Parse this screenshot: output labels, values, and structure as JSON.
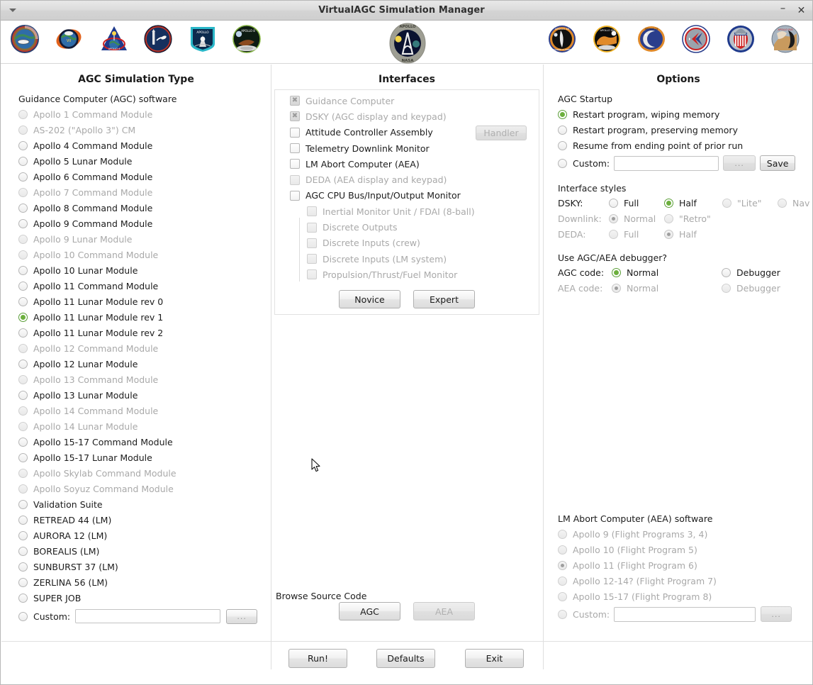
{
  "window": {
    "title": "VirtualAGC Simulation Manager",
    "menu_icon": "caret-down-icon",
    "minimize_label": "–",
    "close_label": "✕"
  },
  "patches": {
    "left": [
      "apollo-1-patch",
      "apollo-as202-patch",
      "apollo-4-patch",
      "apollo-5-patch",
      "apollo-6-patch",
      "apollo-7-patch"
    ],
    "center": "apollo-program-patch",
    "right": [
      "apollo-12-patch",
      "apollo-13-patch",
      "apollo-14-patch",
      "apollo-15-patch",
      "apollo-16-patch",
      "apollo-17-patch"
    ]
  },
  "columns": {
    "agc_sim_type": "AGC Simulation Type",
    "interfaces": "Interfaces",
    "options": "Options"
  },
  "agc_software": {
    "label": "Guidance Computer (AGC) software",
    "items": [
      {
        "label": "Apollo 1 Command Module",
        "enabled": false,
        "selected": false
      },
      {
        "label": "AS-202 (\"Apollo 3\") CM",
        "enabled": false,
        "selected": false
      },
      {
        "label": "Apollo 4 Command Module",
        "enabled": true,
        "selected": false
      },
      {
        "label": "Apollo 5 Lunar Module",
        "enabled": true,
        "selected": false
      },
      {
        "label": "Apollo 6 Command Module",
        "enabled": true,
        "selected": false
      },
      {
        "label": "Apollo 7 Command Module",
        "enabled": false,
        "selected": false
      },
      {
        "label": "Apollo 8 Command Module",
        "enabled": true,
        "selected": false
      },
      {
        "label": "Apollo 9 Command Module",
        "enabled": true,
        "selected": false
      },
      {
        "label": "Apollo 9 Lunar Module",
        "enabled": false,
        "selected": false
      },
      {
        "label": "Apollo 10 Command Module",
        "enabled": false,
        "selected": false
      },
      {
        "label": "Apollo 10 Lunar Module",
        "enabled": true,
        "selected": false
      },
      {
        "label": "Apollo 11 Command Module",
        "enabled": true,
        "selected": false
      },
      {
        "label": "Apollo 11 Lunar Module rev 0",
        "enabled": true,
        "selected": false
      },
      {
        "label": "Apollo 11 Lunar Module rev 1",
        "enabled": true,
        "selected": true
      },
      {
        "label": "Apollo 11 Lunar Module rev 2",
        "enabled": true,
        "selected": false
      },
      {
        "label": "Apollo 12 Command Module",
        "enabled": false,
        "selected": false
      },
      {
        "label": "Apollo 12 Lunar Module",
        "enabled": true,
        "selected": false
      },
      {
        "label": "Apollo 13 Command Module",
        "enabled": false,
        "selected": false
      },
      {
        "label": "Apollo 13 Lunar Module",
        "enabled": true,
        "selected": false
      },
      {
        "label": "Apollo 14 Command Module",
        "enabled": false,
        "selected": false
      },
      {
        "label": "Apollo 14 Lunar Module",
        "enabled": false,
        "selected": false
      },
      {
        "label": "Apollo 15-17 Command Module",
        "enabled": true,
        "selected": false
      },
      {
        "label": "Apollo 15-17 Lunar Module",
        "enabled": true,
        "selected": false
      },
      {
        "label": "Apollo Skylab Command Module",
        "enabled": false,
        "selected": false
      },
      {
        "label": "Apollo Soyuz Command Module",
        "enabled": false,
        "selected": false
      },
      {
        "label": "Validation Suite",
        "enabled": true,
        "selected": false
      },
      {
        "label": "RETREAD 44 (LM)",
        "enabled": true,
        "selected": false
      },
      {
        "label": "AURORA 12 (LM)",
        "enabled": true,
        "selected": false
      },
      {
        "label": "BOREALIS (LM)",
        "enabled": true,
        "selected": false
      },
      {
        "label": "SUNBURST 37 (LM)",
        "enabled": true,
        "selected": false
      },
      {
        "label": "ZERLINA 56 (LM)",
        "enabled": true,
        "selected": false
      },
      {
        "label": "SUPER JOB",
        "enabled": true,
        "selected": false
      }
    ],
    "custom": {
      "label": "Custom:",
      "value": "",
      "placeholder": "",
      "browse_label": "..."
    }
  },
  "interfaces": {
    "items": [
      {
        "label": "Guidance Computer",
        "checked": true,
        "enabled": false,
        "indent": 0
      },
      {
        "label": "DSKY (AGC display and keypad)",
        "checked": true,
        "enabled": false,
        "indent": 0
      },
      {
        "label": "Attitude Controller Assembly",
        "checked": false,
        "enabled": true,
        "indent": 0
      },
      {
        "label": "Telemetry Downlink Monitor",
        "checked": false,
        "enabled": true,
        "indent": 0
      },
      {
        "label": "LM Abort Computer (AEA)",
        "checked": false,
        "enabled": true,
        "indent": 0
      },
      {
        "label": "DEDA (AEA display and keypad)",
        "checked": false,
        "enabled": false,
        "indent": 0
      },
      {
        "label": "AGC CPU Bus/Input/Output Monitor",
        "checked": false,
        "enabled": true,
        "indent": 0
      },
      {
        "label": "Inertial Monitor Unit / FDAI (8-ball)",
        "checked": false,
        "enabled": false,
        "indent": 1
      },
      {
        "label": "Discrete Outputs",
        "checked": false,
        "enabled": false,
        "indent": 1
      },
      {
        "label": "Discrete Inputs (crew)",
        "checked": false,
        "enabled": false,
        "indent": 1
      },
      {
        "label": "Discrete Inputs (LM system)",
        "checked": false,
        "enabled": false,
        "indent": 1
      },
      {
        "label": "Propulsion/Thrust/Fuel Monitor",
        "checked": false,
        "enabled": false,
        "indent": 1
      }
    ],
    "handler_button": "Handler",
    "novice_button": "Novice",
    "expert_button": "Expert"
  },
  "browse_source": {
    "label": "Browse Source Code",
    "agc_button": "AGC",
    "aea_button": "AEA"
  },
  "options": {
    "startup": {
      "label": "AGC Startup",
      "items": [
        {
          "label": "Restart program, wiping memory",
          "selected": true,
          "enabled": true
        },
        {
          "label": "Restart program, preserving memory",
          "selected": false,
          "enabled": true
        },
        {
          "label": "Resume from ending point of prior run",
          "selected": false,
          "enabled": true
        }
      ],
      "custom": {
        "label": "Custom:",
        "value": "",
        "placeholder": "",
        "browse_label": "...",
        "save_label": "Save"
      }
    },
    "interface_styles": {
      "label": "Interface styles",
      "rows": [
        {
          "name": "DSKY:",
          "enabled": true,
          "choices": [
            {
              "label": "Full",
              "selected": false,
              "enabled": true
            },
            {
              "label": "Half",
              "selected": true,
              "enabled": true
            },
            {
              "label": "\"Lite\"",
              "selected": false,
              "enabled": false
            },
            {
              "label": "Nav",
              "selected": false,
              "enabled": false
            }
          ]
        },
        {
          "name": "Downlink:",
          "enabled": false,
          "choices": [
            {
              "label": "Normal",
              "selected": true,
              "enabled": false
            },
            {
              "label": "\"Retro\"",
              "selected": false,
              "enabled": false
            }
          ]
        },
        {
          "name": "DEDA:",
          "enabled": false,
          "choices": [
            {
              "label": "Full",
              "selected": false,
              "enabled": false
            },
            {
              "label": "Half",
              "selected": true,
              "enabled": false
            }
          ]
        }
      ]
    },
    "debugger": {
      "label": "Use AGC/AEA debugger?",
      "rows": [
        {
          "name": "AGC code:",
          "enabled": true,
          "choices": [
            {
              "label": "Normal",
              "selected": true,
              "enabled": true
            },
            {
              "label": "Debugger",
              "selected": false,
              "enabled": true
            }
          ]
        },
        {
          "name": "AEA code:",
          "enabled": false,
          "choices": [
            {
              "label": "Normal",
              "selected": true,
              "enabled": false
            },
            {
              "label": "Debugger",
              "selected": false,
              "enabled": false
            }
          ]
        }
      ]
    },
    "aea_software": {
      "label": "LM Abort Computer (AEA) software",
      "items": [
        {
          "label": "Apollo 9 (Flight Programs 3, 4)",
          "selected": false,
          "enabled": false
        },
        {
          "label": "Apollo 10 (Flight Program 5)",
          "selected": false,
          "enabled": false
        },
        {
          "label": "Apollo 11 (Flight Program 6)",
          "selected": true,
          "enabled": false
        },
        {
          "label": "Apollo 12-14? (Flight Program 7)",
          "selected": false,
          "enabled": false
        },
        {
          "label": "Apollo 15-17 (Flight Program 8)",
          "selected": false,
          "enabled": false
        }
      ],
      "custom": {
        "label": "Custom:",
        "value": "",
        "placeholder": "",
        "browse_label": "..."
      }
    }
  },
  "footer": {
    "run_label": "Run!",
    "defaults_label": "Defaults",
    "exit_label": "Exit"
  },
  "colors": {
    "accent_green": "#6cb03d",
    "text": "#1b1b1b",
    "disabled_text": "#a9a9a9"
  }
}
